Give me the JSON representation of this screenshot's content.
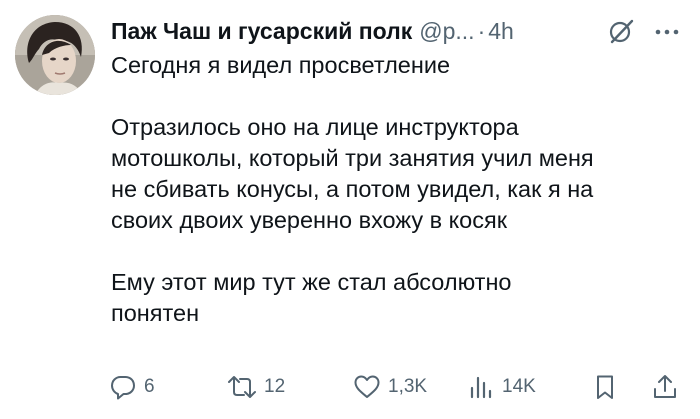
{
  "tweet": {
    "author_name": "Паж Чаш и гусарский полк",
    "handle": "@p...",
    "separator": "·",
    "time": "4h",
    "paragraphs": [
      "Сегодня я видел просветление",
      "Отразилось оно на лице инструктора\nмотошколы, который три занятия учил меня\nне сбивать конусы, а потом увидел, как я на\nсвоих двоих уверенно вхожу в косяк",
      "Ему этот мир тут же стал абсолютно\nпонятен"
    ]
  },
  "actions": {
    "replies": "6",
    "reposts": "12",
    "likes": "1,3K",
    "views": "14K"
  },
  "icons": {
    "reply": "reply-icon",
    "repost": "repost-icon",
    "like": "heart-icon",
    "views": "views-icon",
    "bookmark": "bookmark-icon",
    "share": "share-icon",
    "grok": "grok-icon",
    "more": "more-icon"
  },
  "colors": {
    "text": "#0f1419",
    "secondary": "#536471",
    "background": "#ffffff"
  }
}
